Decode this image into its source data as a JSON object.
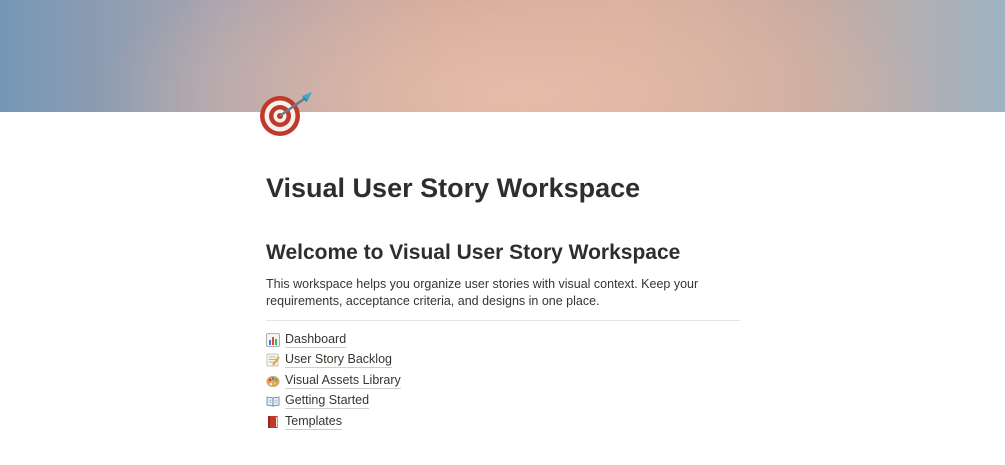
{
  "page": {
    "title": "Visual User Story Workspace",
    "heading": "Welcome to Visual User Story Workspace",
    "description": "This workspace helps you organize user stories with visual context. Keep your requirements, acceptance criteria, and designs in one place."
  },
  "links": [
    {
      "label": "Dashboard",
      "icon": "bar-chart-icon"
    },
    {
      "label": "User Story Backlog",
      "icon": "memo-icon"
    },
    {
      "label": "Visual Assets Library",
      "icon": "palette-icon"
    },
    {
      "label": "Getting Started",
      "icon": "open-book-icon"
    },
    {
      "label": "Templates",
      "icon": "closed-book-icon"
    }
  ],
  "page_icon": "direct-hit-icon"
}
